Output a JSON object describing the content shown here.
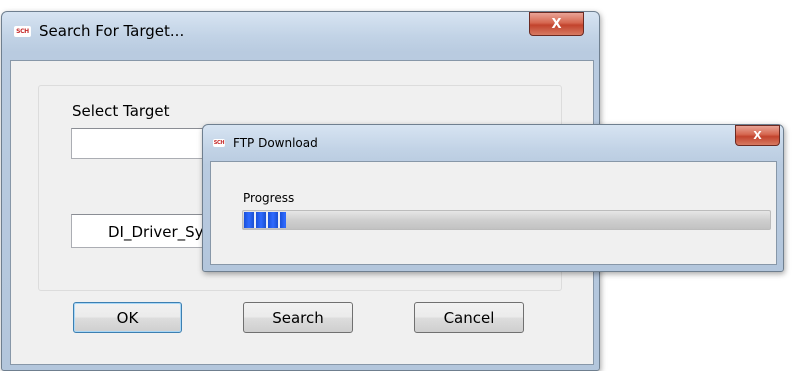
{
  "search_dialog": {
    "title": "Search For Target...",
    "app_icon_text": "SCH",
    "close_glyph": "X",
    "select_target_label": "Select Target",
    "select_target_value": "",
    "target_value": "DI_Driver_Sy",
    "buttons": {
      "ok": "OK",
      "search": "Search",
      "cancel": "Cancel"
    }
  },
  "ftp_dialog": {
    "title": "FTP Download",
    "app_icon_text": "SCH",
    "close_glyph": "X",
    "progress_label": "Progress",
    "progress_percent": 8
  },
  "colors": {
    "progress_fill": "#1f5ef0",
    "close_button": "#c9462f",
    "default_button_border": "#3c7fb1"
  }
}
